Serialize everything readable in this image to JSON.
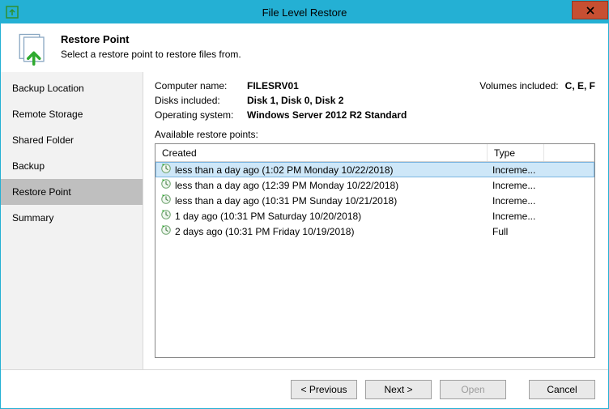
{
  "window": {
    "title": "File Level Restore"
  },
  "header": {
    "heading": "Restore Point",
    "subheading": "Select a restore point to restore files from."
  },
  "sidebar": {
    "items": [
      {
        "label": "Backup Location"
      },
      {
        "label": "Remote Storage"
      },
      {
        "label": "Shared Folder"
      },
      {
        "label": "Backup"
      },
      {
        "label": "Restore Point"
      },
      {
        "label": "Summary"
      }
    ],
    "selected_index": 4
  },
  "info": {
    "computer_label": "Computer name:",
    "computer_value": "FILESRV01",
    "volumes_label": "Volumes included:",
    "volumes_value": "C, E, F",
    "disks_label": "Disks included:",
    "disks_value": "Disk 1, Disk 0, Disk 2",
    "os_label": "Operating system:",
    "os_value": "Windows Server 2012 R2 Standard",
    "available_label": "Available restore points:"
  },
  "table": {
    "columns": {
      "created": "Created",
      "type": "Type"
    },
    "rows": [
      {
        "created": "less than a day ago (1:02 PM Monday 10/22/2018)",
        "type": "Increme..."
      },
      {
        "created": "less than a day ago (12:39 PM Monday 10/22/2018)",
        "type": "Increme..."
      },
      {
        "created": "less than a day ago (10:31 PM Sunday 10/21/2018)",
        "type": "Increme..."
      },
      {
        "created": "1 day ago (10:31 PM Saturday 10/20/2018)",
        "type": "Increme..."
      },
      {
        "created": "2 days ago (10:31 PM Friday 10/19/2018)",
        "type": "Full"
      }
    ],
    "selected_index": 0
  },
  "footer": {
    "previous": "< Previous",
    "next": "Next >",
    "open": "Open",
    "cancel": "Cancel"
  }
}
